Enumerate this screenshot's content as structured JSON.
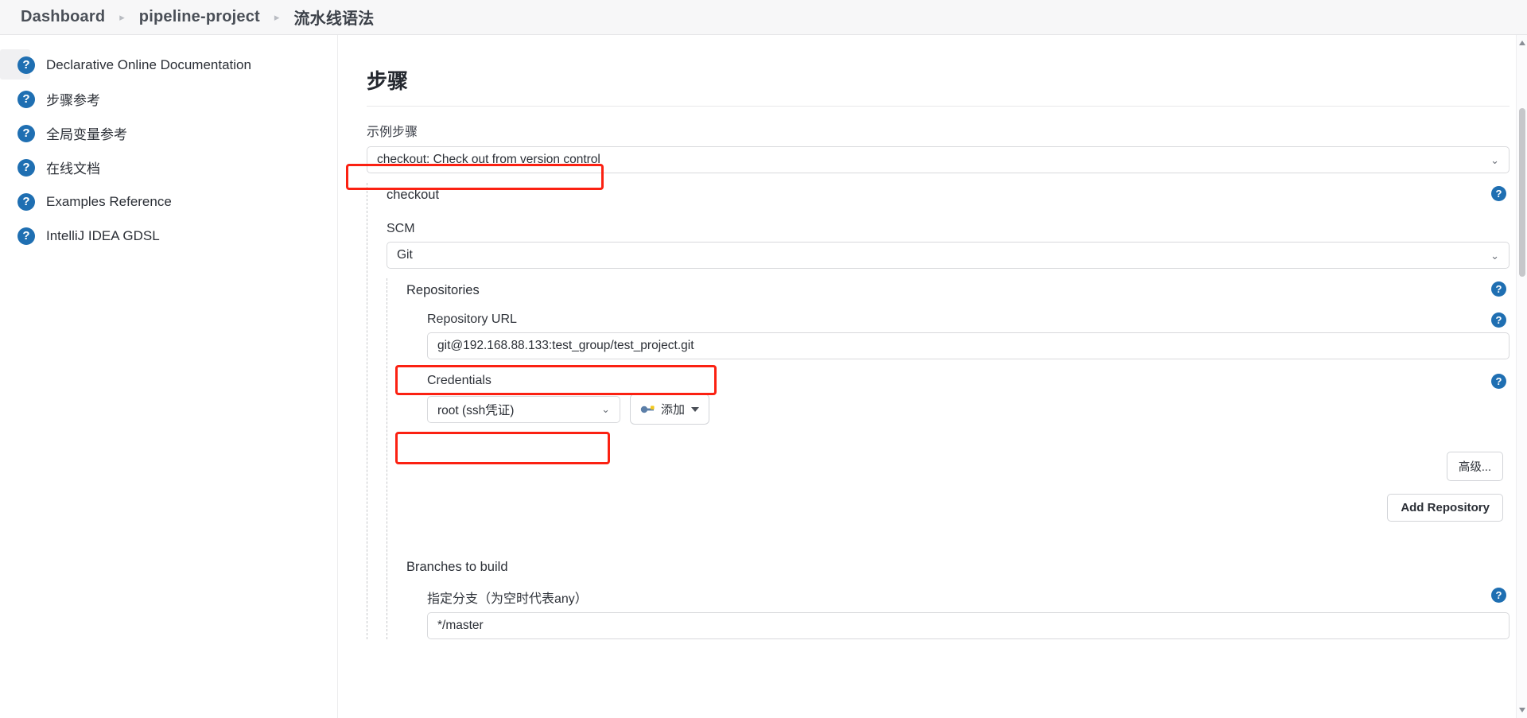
{
  "breadcrumb": {
    "items": [
      {
        "label": "Dashboard"
      },
      {
        "label": "pipeline-project"
      },
      {
        "label": "流水线语法"
      }
    ],
    "separator": "▸"
  },
  "sidebar": {
    "items": [
      {
        "label": "Declarative Online Documentation",
        "icon": "help-icon"
      },
      {
        "label": "步骤参考",
        "icon": "help-icon"
      },
      {
        "label": "全局变量参考",
        "icon": "help-icon"
      },
      {
        "label": "在线文档",
        "icon": "help-icon"
      },
      {
        "label": "Examples Reference",
        "icon": "help-icon"
      },
      {
        "label": "IntelliJ IDEA GDSL",
        "icon": "help-icon"
      }
    ]
  },
  "main": {
    "title": "步骤",
    "sample_step_label": "示例步骤",
    "sample_step_value": "checkout: Check out from version control",
    "checkout_label": "checkout",
    "scm_label": "SCM",
    "scm_value": "Git",
    "repositories_label": "Repositories",
    "repository_url_label": "Repository URL",
    "repository_url_value": "git@192.168.88.133:test_group/test_project.git",
    "credentials_label": "Credentials",
    "credentials_value": "root (ssh凭证)",
    "add_credentials_label": "添加",
    "advanced_button": "高级...",
    "add_repository_button": "Add Repository",
    "branches_to_build_label": "Branches to build",
    "branch_specifier_label": "指定分支（为空时代表any）",
    "branch_specifier_value": "*/master",
    "help_glyph": "?",
    "chevron": "⌄"
  },
  "colors": {
    "highlight": "#fb2112",
    "help_blue": "#1f6fb2",
    "breadcrumb_bg": "#f7f7f8"
  }
}
